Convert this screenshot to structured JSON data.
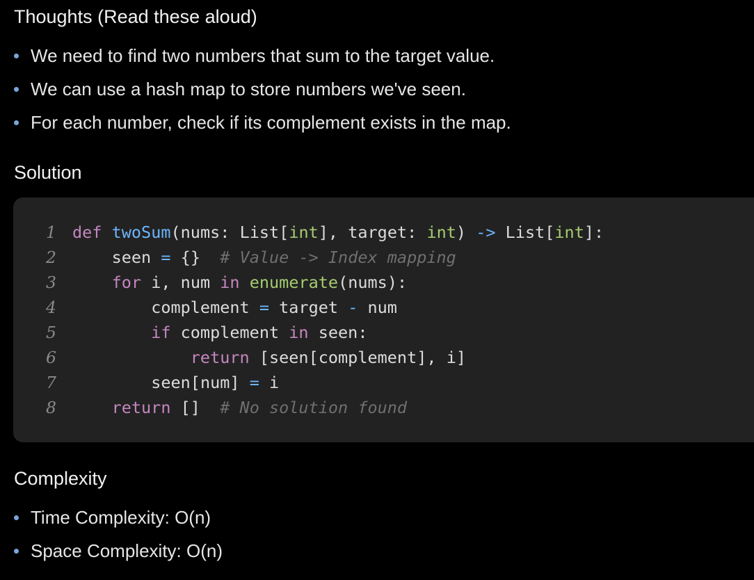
{
  "thoughts": {
    "heading": "Thoughts (Read these aloud)",
    "items": [
      "We need to find two numbers that sum to the target value.",
      "We can use a hash map to store numbers we've seen.",
      "For each number, check if its complement exists in the map."
    ]
  },
  "solution": {
    "heading": "Solution",
    "line_numbers": [
      "1",
      "2",
      "3",
      "4",
      "5",
      "6",
      "7",
      "8"
    ],
    "code_lines": [
      "def twoSum(nums: List[int], target: int) -> List[int]:",
      "    seen = {}  # Value -> Index mapping",
      "    for i, num in enumerate(nums):",
      "        complement = target - num",
      "        if complement in seen:",
      "            return [seen[complement], i]",
      "        seen[num] = i",
      "    return []  # No solution found"
    ]
  },
  "complexity": {
    "heading": "Complexity",
    "items": [
      "Time Complexity: O(n)",
      "Space Complexity: O(n)"
    ]
  },
  "colors": {
    "background": "#000000",
    "code_background": "#222222",
    "bullet_dot": "#7aa6da",
    "keyword": "#c586c0",
    "function": "#6cb6ff",
    "type": "#a6cc70",
    "comment": "#6f6f6f"
  }
}
